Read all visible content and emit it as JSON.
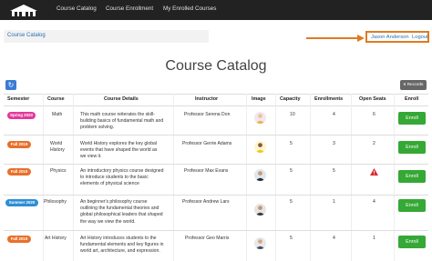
{
  "nav": {
    "links": [
      "Course Catalog",
      "Course Enrollment",
      "My Enrolled Courses"
    ]
  },
  "breadcrumb": "Course Catalog",
  "user": {
    "name": "Jason Anderson",
    "logout": "Logout"
  },
  "page_title": "Course Catalog",
  "records_badge": "6 Records",
  "table": {
    "headers": [
      "Semester",
      "Course",
      "Course Details",
      "Instructor",
      "Image",
      "Capacity",
      "Enrollments",
      "Open Seats",
      "Enroll"
    ],
    "rows": [
      {
        "semester": "Spring 2020",
        "semester_color": "#e2399a",
        "course": "Math",
        "details": [
          "This math course reiterates the skill-",
          "building basics of fundamental math and",
          "problem solving."
        ],
        "instructor": "Professor Serena Don",
        "capacity": "10",
        "enrollments": "4",
        "open_seats": "6",
        "full": false,
        "enroll_label": "Enroll"
      },
      {
        "semester": "Fall 2019",
        "semester_color": "#e8702a",
        "course": [
          "World",
          "History"
        ],
        "details": [
          "World History explores the key global",
          "events that have shaped the world as",
          "we view it."
        ],
        "instructor": "Professor Gerrie Adams",
        "capacity": "5",
        "enrollments": "3",
        "open_seats": "2",
        "full": false,
        "enroll_label": "Enroll"
      },
      {
        "semester": "Fall 2019",
        "semester_color": "#e8702a",
        "course": "Physics",
        "details": [
          "An introductory physics course designed",
          "to introduce students to the basic",
          "elements of physical science"
        ],
        "instructor": "Professor Max Evans",
        "capacity": "5",
        "enrollments": "5",
        "open_seats": "",
        "full": true,
        "enroll_label": "Enroll"
      },
      {
        "semester": "Summer 2020",
        "semester_color": "#2d8ed6",
        "course": "Philosophy",
        "details": [
          "An beginner's philosophy course",
          "outlining the fundamental theories and",
          "global philosophical leaders that shaped",
          "the way we view the world."
        ],
        "instructor": "Professor Andrew Lars",
        "capacity": "5",
        "enrollments": "1",
        "open_seats": "4",
        "full": false,
        "enroll_label": "Enroll"
      },
      {
        "semester": "Fall 2019",
        "semester_color": "#e8702a",
        "course": "Art History",
        "details": [
          "Art History introduces students to the",
          "fundamental elements and key figures in",
          "world art, architecture, and expression."
        ],
        "instructor": "Professor Geo Marris",
        "capacity": "5",
        "enrollments": "4",
        "open_seats": "1",
        "full": false,
        "enroll_label": "Enroll"
      }
    ]
  }
}
